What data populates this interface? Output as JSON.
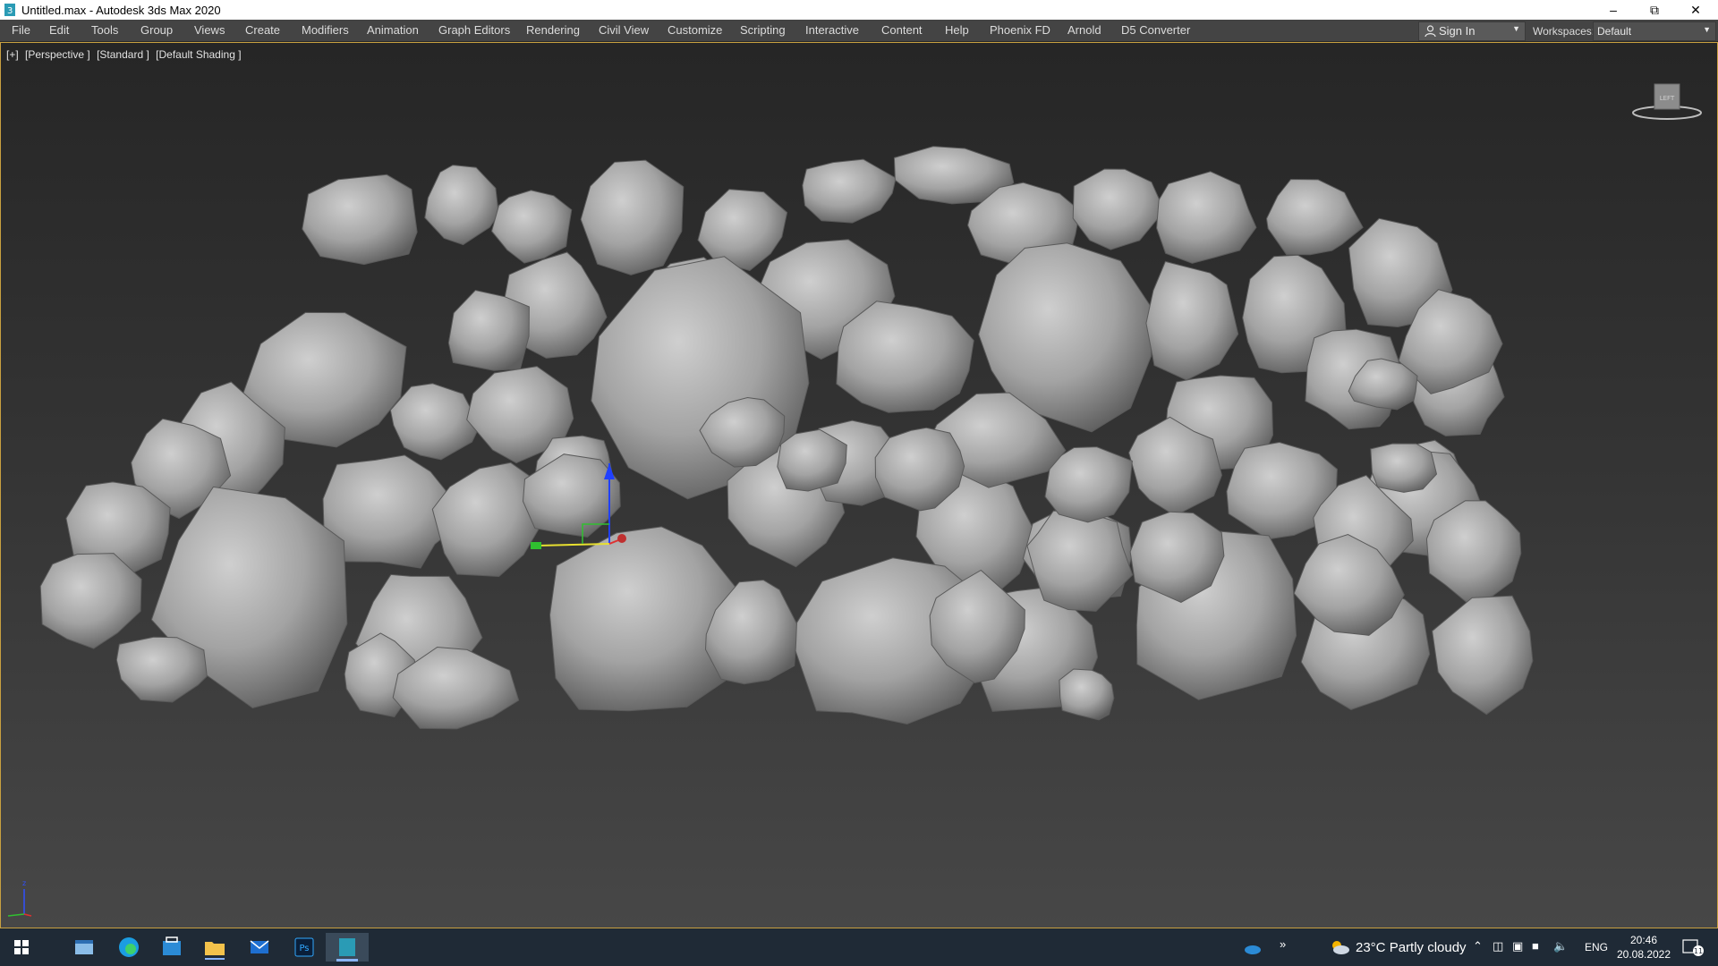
{
  "window": {
    "title": "Untitled.max - Autodesk 3ds Max 2020",
    "controls": [
      "minimize-icon",
      "restore-icon",
      "close-icon"
    ]
  },
  "menubar": {
    "items": [
      "File",
      "Edit",
      "Tools",
      "Group",
      "Views",
      "Create",
      "Modifiers",
      "Animation",
      "Graph Editors",
      "Rendering",
      "Civil View",
      "Customize",
      "Scripting",
      "Interactive",
      "Content",
      "Help",
      "Phoenix FD",
      "Arnold",
      "D5 Converter"
    ]
  },
  "account": {
    "signin_label": "Sign In"
  },
  "workspaces": {
    "label": "Workspaces:",
    "value": "Default"
  },
  "viewport": {
    "labels": [
      "[+]",
      "[Perspective ]",
      "[Standard ]",
      "[Default Shading ]"
    ],
    "viewcube_face": "LEFT",
    "gizmo_axes": [
      "x",
      "y",
      "z"
    ]
  },
  "taskbar": {
    "apps": [
      "windows-start-icon",
      "file-explorer-icon",
      "edge-icon",
      "store-icon",
      "folder-icon",
      "mail-icon",
      "photoshop-icon",
      "3dsmax-icon"
    ],
    "photoshop_label": "Ps",
    "weather": {
      "temp": "23°C",
      "condition": "Partly cloudy"
    },
    "language": "ENG",
    "time": "20:46",
    "date": "20.08.2022",
    "notification_count": "11"
  },
  "colors": {
    "titlebar": "#ffffff",
    "menubar": "#444444",
    "viewport_top": "#262626",
    "viewport_bottom": "#474747",
    "viewport_border": "#c8a040",
    "rock": "#a6a6a6",
    "taskbar": "#1f2a36",
    "axis_x": "#e03030",
    "axis_y": "#30c030",
    "axis_z": "#2040ff"
  }
}
